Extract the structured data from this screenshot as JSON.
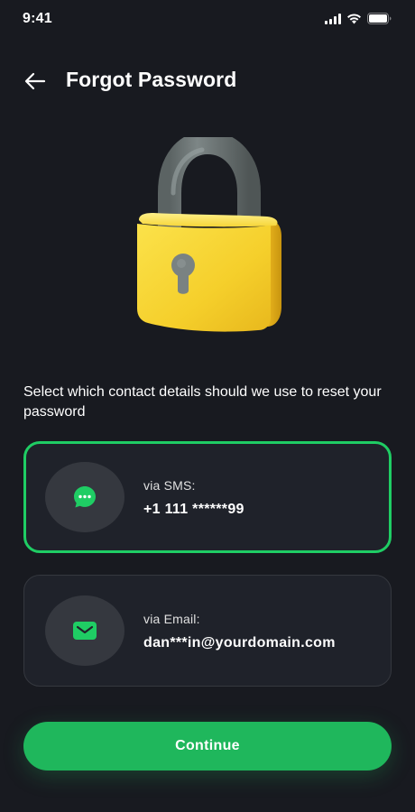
{
  "status_bar": {
    "time": "9:41",
    "icons": [
      "signal-icon",
      "wifi-icon",
      "battery-icon"
    ]
  },
  "header": {
    "back_icon": "arrow-left-icon",
    "title": "Forgot Password"
  },
  "illustration": {
    "icon": "padlock-icon",
    "colors": {
      "lock_body": "#f7d431",
      "shackle": "#6b7474",
      "keyhole": "#7a8282"
    }
  },
  "description": "Select which contact details should we use to reset your password",
  "options": [
    {
      "icon": "chat-bubble-icon",
      "label": "via SMS:",
      "value": "+1 111 ******99",
      "selected": true
    },
    {
      "icon": "mail-icon",
      "label": "via Email:",
      "value": "dan***in@yourdomain.com",
      "selected": false
    }
  ],
  "continue_label": "Continue",
  "colors": {
    "background": "#181a20",
    "card": "#1f222a",
    "accent": "#1fb75c",
    "selected_border": "#1fcd64"
  }
}
